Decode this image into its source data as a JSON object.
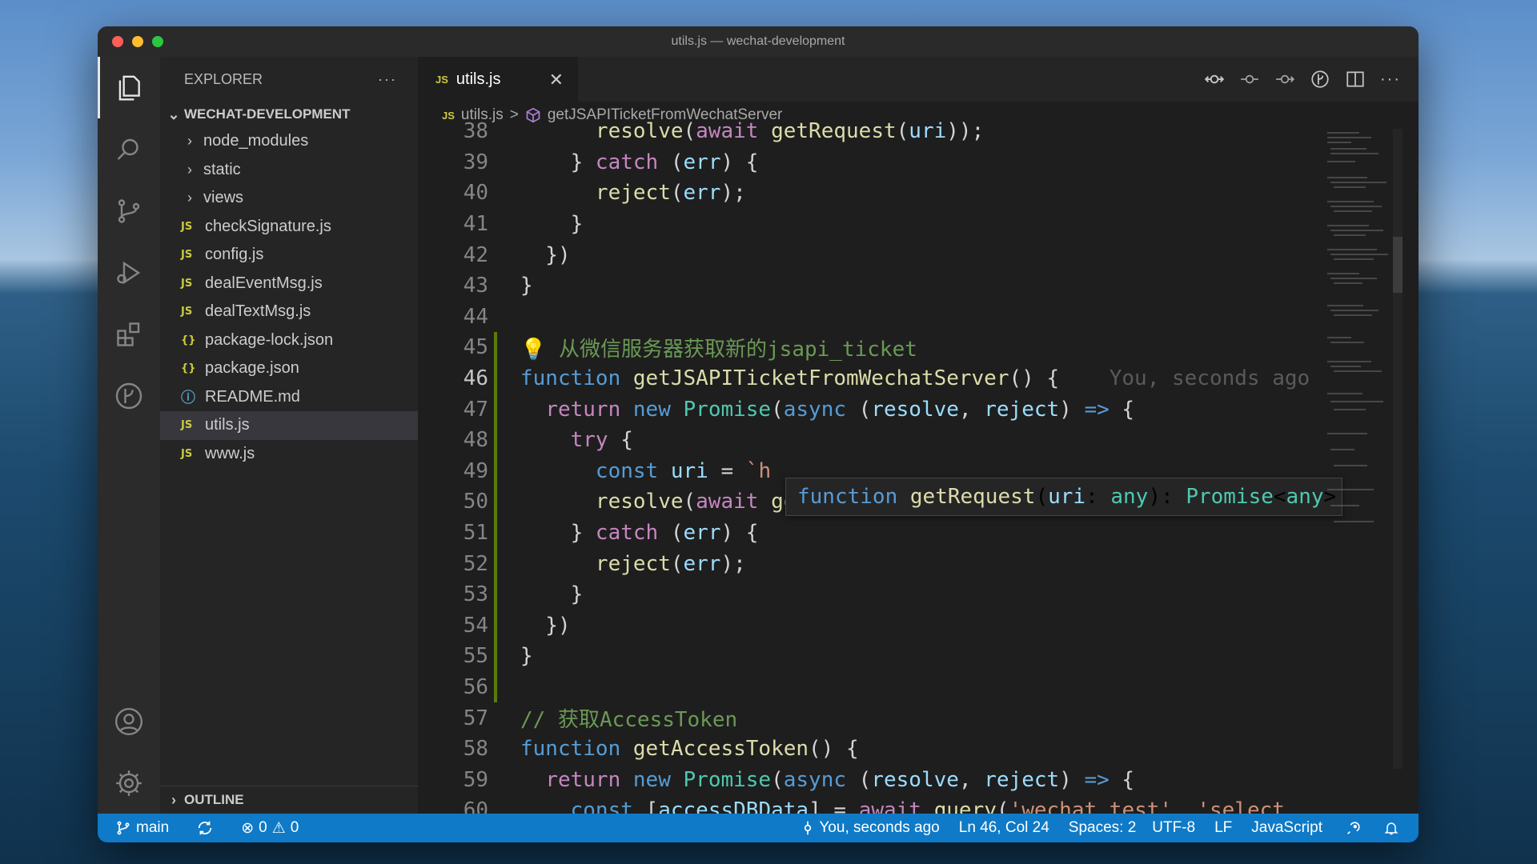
{
  "window": {
    "title": "utils.js — wechat-development"
  },
  "sidebar": {
    "header": "EXPLORER",
    "more": "···",
    "section": "WECHAT-DEVELOPMENT",
    "items": [
      {
        "label": "node_modules",
        "type": "folder"
      },
      {
        "label": "static",
        "type": "folder"
      },
      {
        "label": "views",
        "type": "folder"
      },
      {
        "label": "checkSignature.js",
        "type": "js",
        "icon": "JS"
      },
      {
        "label": "config.js",
        "type": "js",
        "icon": "JS"
      },
      {
        "label": "dealEventMsg.js",
        "type": "js",
        "icon": "JS"
      },
      {
        "label": "dealTextMsg.js",
        "type": "js",
        "icon": "JS"
      },
      {
        "label": "package-lock.json",
        "type": "json",
        "icon": "{}"
      },
      {
        "label": "package.json",
        "type": "json",
        "icon": "{}"
      },
      {
        "label": "README.md",
        "type": "info",
        "icon": "ⓘ"
      },
      {
        "label": "utils.js",
        "type": "js",
        "icon": "JS",
        "selected": true
      },
      {
        "label": "www.js",
        "type": "js",
        "icon": "JS"
      }
    ],
    "outline": "OUTLINE"
  },
  "tabs": [
    {
      "label": "utils.js",
      "icon": "JS",
      "close": "✕"
    }
  ],
  "breadcrumb": {
    "file_icon": "JS",
    "file": "utils.js",
    "separator": ">",
    "symbol": "getJSAPITicketFromWechatServer"
  },
  "code": {
    "current_line": 46,
    "lines": [
      {
        "n": "38",
        "tokens": [
          [
            "      ",
            ""
          ],
          [
            "resolve",
            "fn"
          ],
          [
            "(",
            ""
          ],
          [
            "await",
            "kw2"
          ],
          [
            " ",
            ""
          ],
          [
            "getRequest",
            "fn"
          ],
          [
            "(",
            ""
          ],
          [
            "uri",
            "var"
          ],
          [
            "));",
            ""
          ]
        ]
      },
      {
        "n": "39",
        "tokens": [
          [
            "    } ",
            ""
          ],
          [
            "catch",
            "kw2"
          ],
          [
            " (",
            ""
          ],
          [
            "err",
            "var"
          ],
          [
            ") {",
            ""
          ]
        ]
      },
      {
        "n": "40",
        "tokens": [
          [
            "      ",
            ""
          ],
          [
            "reject",
            "fn"
          ],
          [
            "(",
            ""
          ],
          [
            "err",
            "var"
          ],
          [
            ");",
            ""
          ]
        ]
      },
      {
        "n": "41",
        "tokens": [
          [
            "    }",
            ""
          ]
        ]
      },
      {
        "n": "42",
        "tokens": [
          [
            "  })",
            ""
          ]
        ]
      },
      {
        "n": "43",
        "tokens": [
          [
            "}",
            ""
          ]
        ]
      },
      {
        "n": "44",
        "tokens": []
      },
      {
        "n": "45",
        "tokens": [
          [
            "💡 ",
            "cm"
          ],
          [
            "从微信服务器获取新的jsapi_ticket",
            "cm"
          ]
        ]
      },
      {
        "n": "46",
        "tokens": [
          [
            "function",
            "kw"
          ],
          [
            " ",
            ""
          ],
          [
            "getJSAPITicketFromWechatServer",
            "fn"
          ],
          [
            "() {",
            ""
          ],
          [
            "    You, seconds ago",
            "blame"
          ]
        ]
      },
      {
        "n": "47",
        "tokens": [
          [
            "  ",
            ""
          ],
          [
            "return",
            "kw2"
          ],
          [
            " ",
            ""
          ],
          [
            "new",
            "kw"
          ],
          [
            " ",
            ""
          ],
          [
            "Promise",
            "cls"
          ],
          [
            "(",
            ""
          ],
          [
            "async",
            "kw"
          ],
          [
            " (",
            ""
          ],
          [
            "resolve",
            "var"
          ],
          [
            ", ",
            ""
          ],
          [
            "reject",
            "var"
          ],
          [
            ") ",
            ""
          ],
          [
            "=>",
            "kw"
          ],
          [
            " {",
            ""
          ]
        ]
      },
      {
        "n": "48",
        "tokens": [
          [
            "    ",
            ""
          ],
          [
            "try",
            "kw2"
          ],
          [
            " {",
            ""
          ]
        ]
      },
      {
        "n": "49",
        "tokens": [
          [
            "      ",
            ""
          ],
          [
            "const",
            "kw"
          ],
          [
            " ",
            ""
          ],
          [
            "uri",
            "var"
          ],
          [
            " = ",
            ""
          ],
          [
            "`h",
            "str"
          ]
        ]
      },
      {
        "n": "50",
        "tokens": [
          [
            "      ",
            ""
          ],
          [
            "resolve",
            "fn"
          ],
          [
            "(",
            ""
          ],
          [
            "await",
            "kw2"
          ],
          [
            " ",
            ""
          ],
          [
            "getRequest",
            "fn"
          ],
          [
            "(",
            ""
          ],
          [
            "uri",
            "var"
          ],
          [
            "));",
            ""
          ]
        ]
      },
      {
        "n": "51",
        "tokens": [
          [
            "    } ",
            ""
          ],
          [
            "catch",
            "kw2"
          ],
          [
            " (",
            ""
          ],
          [
            "err",
            "var"
          ],
          [
            ") {",
            ""
          ]
        ]
      },
      {
        "n": "52",
        "tokens": [
          [
            "      ",
            ""
          ],
          [
            "reject",
            "fn"
          ],
          [
            "(",
            ""
          ],
          [
            "err",
            "var"
          ],
          [
            ");",
            ""
          ]
        ]
      },
      {
        "n": "53",
        "tokens": [
          [
            "    }",
            ""
          ]
        ]
      },
      {
        "n": "54",
        "tokens": [
          [
            "  })",
            ""
          ]
        ]
      },
      {
        "n": "55",
        "tokens": [
          [
            "}",
            ""
          ]
        ]
      },
      {
        "n": "56",
        "tokens": []
      },
      {
        "n": "57",
        "tokens": [
          [
            "// 获取AccessToken",
            "cm"
          ]
        ]
      },
      {
        "n": "58",
        "tokens": [
          [
            "function",
            "kw"
          ],
          [
            " ",
            ""
          ],
          [
            "getAccessToken",
            "fn"
          ],
          [
            "() {",
            ""
          ]
        ]
      },
      {
        "n": "59",
        "tokens": [
          [
            "  ",
            ""
          ],
          [
            "return",
            "kw2"
          ],
          [
            " ",
            ""
          ],
          [
            "new",
            "kw"
          ],
          [
            " ",
            ""
          ],
          [
            "Promise",
            "cls"
          ],
          [
            "(",
            ""
          ],
          [
            "async",
            "kw"
          ],
          [
            " (",
            ""
          ],
          [
            "resolve",
            "var"
          ],
          [
            ", ",
            ""
          ],
          [
            "reject",
            "var"
          ],
          [
            ") ",
            ""
          ],
          [
            "=>",
            "kw"
          ],
          [
            " {",
            ""
          ]
        ]
      },
      {
        "n": "60",
        "tokens": [
          [
            "    ",
            ""
          ],
          [
            "const",
            "kw"
          ],
          [
            " [",
            ""
          ],
          [
            "accessDBData",
            "var"
          ],
          [
            "] = ",
            ""
          ],
          [
            "await",
            "kw2"
          ],
          [
            " ",
            ""
          ],
          [
            "query",
            "fn"
          ],
          [
            "(",
            ""
          ],
          [
            "'wechat_test'",
            "str"
          ],
          [
            ", ",
            ""
          ],
          [
            "'select",
            "str"
          ]
        ]
      }
    ]
  },
  "hover": {
    "tokens": [
      [
        "function",
        "kw"
      ],
      [
        " ",
        ""
      ],
      [
        "getRequest",
        "fn"
      ],
      [
        "(",
        ""
      ],
      [
        "uri",
        "var"
      ],
      [
        ": ",
        ""
      ],
      [
        "any",
        "cls"
      ],
      [
        "): ",
        ""
      ],
      [
        "Promise",
        "cls"
      ],
      [
        "<",
        ""
      ],
      [
        "any",
        "cls"
      ],
      [
        ">",
        ""
      ]
    ]
  },
  "statusbar": {
    "branch": "main",
    "errors": "0",
    "warnings": "0",
    "blame": "You, seconds ago",
    "position": "Ln 46, Col 24",
    "spaces": "Spaces: 2",
    "encoding": "UTF-8",
    "eol": "LF",
    "language": "JavaScript"
  },
  "colors": {
    "accent": "#0f7ac7",
    "js_icon": "#cbcb41",
    "json_icon": "#cbcb41",
    "info_icon": "#519aba"
  }
}
